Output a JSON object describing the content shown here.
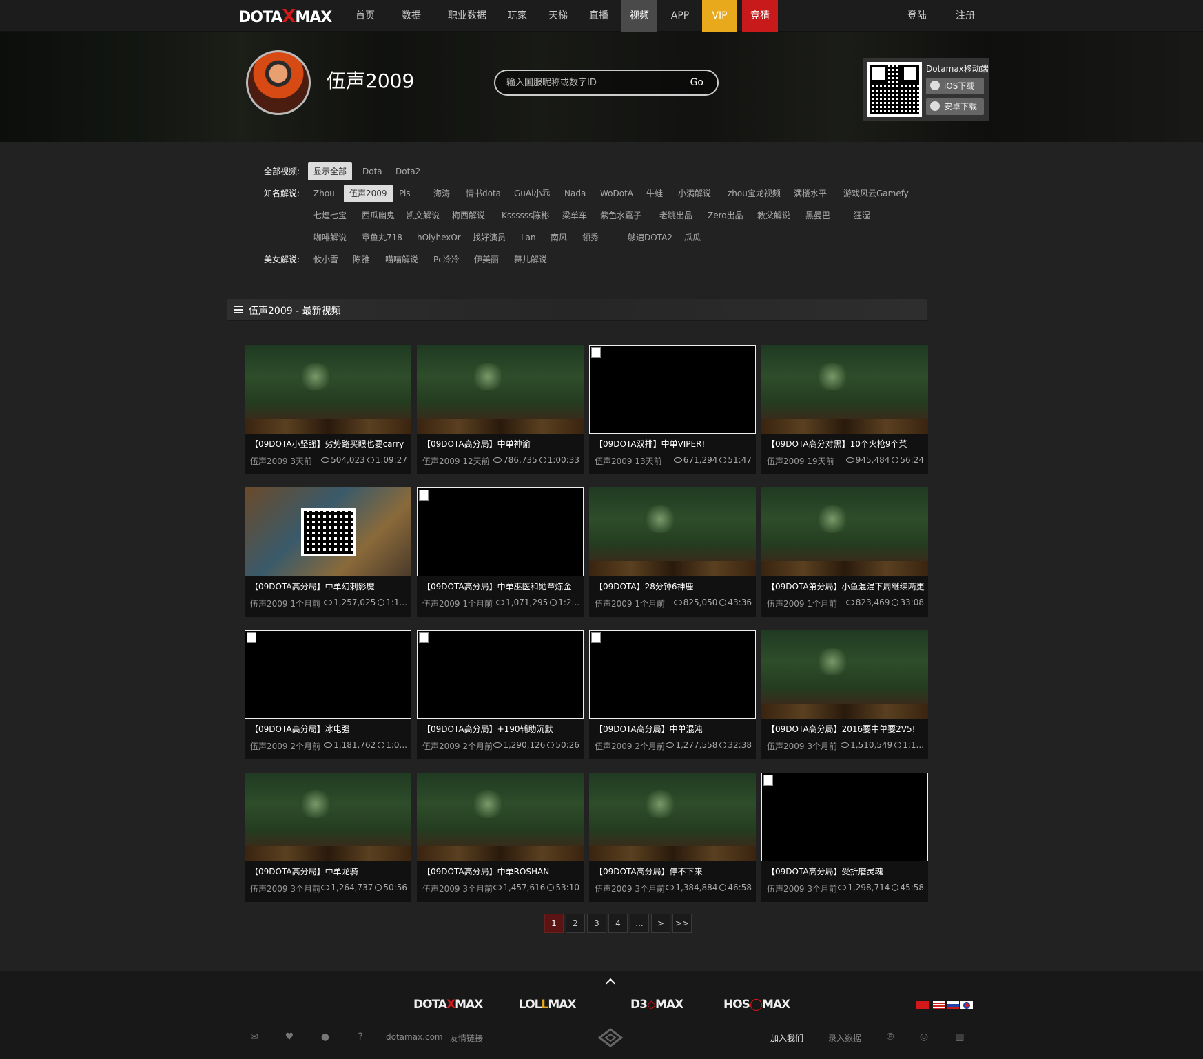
{
  "nav": {
    "logo_left": "DOTA",
    "logo_x": "X",
    "logo_right": "MAX",
    "items": [
      "首页",
      "数据",
      "职业数据",
      "玩家",
      "天梯",
      "直播",
      "视频",
      "APP",
      "VIP",
      "竞猜"
    ],
    "login": "登陆",
    "register": "注册",
    "active_item": "视频",
    "vip_color": "#e8a91c",
    "bet_color": "#c81a1a"
  },
  "profile": {
    "name": "伍声2009"
  },
  "search": {
    "placeholder": "输入国服昵称或数字ID",
    "go": "Go"
  },
  "mobile": {
    "title": "Dotamax移动端",
    "ios": "iOS下载",
    "android": "安卓下载"
  },
  "filters": {
    "all_label": "全部视频:",
    "all": [
      "显示全部",
      "Dota",
      "Dota2"
    ],
    "famous_label": "知名解说:",
    "famous_row1": [
      "Zhou",
      "伍声2009",
      "Pis",
      "海涛",
      "情书dota",
      "GuAi小乖",
      "Nada",
      "WoDotA",
      "牛蛙",
      "小满解说",
      "zhou宝龙视频",
      "满楼水平",
      "游戏风云Gamefy"
    ],
    "famous_row2": [
      "七煌七宝",
      "西瓜幽鬼",
      "凯文解说",
      "梅西解说",
      "Kssssss陈彬",
      "梁单车",
      "紫色水嘉子",
      "老跳出品",
      "Zero出品",
      "教父解说",
      "黑曼巴",
      "狂湿"
    ],
    "famous_row3": [
      "咖啡解说",
      "章鱼丸718",
      "hOlyhexOr",
      "找好演员",
      "Lan",
      "南风",
      "领秀",
      "够速DOTA2",
      "瓜瓜"
    ],
    "beauty_label": "美女解说:",
    "beauty": [
      "攸小雪",
      "陈雅",
      "喵喵解说",
      "Pc冷冷",
      "伊美丽",
      "舞儿解说"
    ]
  },
  "section": {
    "title": "伍声2009 - 最新视频"
  },
  "videos": [
    {
      "title": "【09DOTA小坚强】劣势路买眼也要carry",
      "author": "伍声2009",
      "time": "3天前",
      "views": "504,023",
      "duration": "1:09:27",
      "thumb": "img"
    },
    {
      "title": "【09DOTA高分局】中单神谕",
      "author": "伍声2009",
      "time": "12天前",
      "views": "786,735",
      "duration": "1:00:33",
      "thumb": "img"
    },
    {
      "title": "【09DOTA双排】中单VIPER!",
      "author": "伍声2009",
      "time": "13天前",
      "views": "671,294",
      "duration": "51:47",
      "thumb": "blank"
    },
    {
      "title": "【09DOTA高分对黑】10个火枪9个菜",
      "author": "伍声2009",
      "time": "19天前",
      "views": "945,484",
      "duration": "56:24",
      "thumb": "img"
    },
    {
      "title": "【09DOTA高分局】中单幻刺影魔",
      "author": "伍声2009",
      "time": "1个月前",
      "views": "1,257,025",
      "duration": "1:1...",
      "thumb": "qr"
    },
    {
      "title": "【09DOTA高分局】中单巫医和勋章炼金",
      "author": "伍声2009",
      "time": "1个月前",
      "views": "1,071,295",
      "duration": "1:2...",
      "thumb": "blank"
    },
    {
      "title": "【09DOTA】28分钟6神鹿",
      "author": "伍声2009",
      "time": "1个月前",
      "views": "825,050",
      "duration": "43:36",
      "thumb": "img"
    },
    {
      "title": "【09DOTA第分局】小鱼混混下周继续两更",
      "author": "伍声2009",
      "time": "1个月前",
      "views": "823,469",
      "duration": "33:08",
      "thumb": "img"
    },
    {
      "title": "【09DOTA高分局】冰电强",
      "author": "伍声2009",
      "time": "2个月前",
      "views": "1,181,762",
      "duration": "1:0...",
      "thumb": "blank"
    },
    {
      "title": "【09DOTA高分局】+190辅助沉默",
      "author": "伍声2009",
      "time": "2个月前",
      "views": "1,290,126",
      "duration": "50:26",
      "thumb": "blank"
    },
    {
      "title": "【09DOTA高分局】中单混沌",
      "author": "伍声2009",
      "time": "2个月前",
      "views": "1,277,558",
      "duration": "32:38",
      "thumb": "blank"
    },
    {
      "title": "【09DOTA高分局】2016要中单要2V5!",
      "author": "伍声2009",
      "time": "3个月前",
      "views": "1,510,549",
      "duration": "1:1...",
      "thumb": "img"
    },
    {
      "title": "【09DOTA高分局】中单龙骑",
      "author": "伍声2009",
      "time": "3个月前",
      "views": "1,264,737",
      "duration": "50:56",
      "thumb": "img"
    },
    {
      "title": "【09DOTA高分局】中单ROSHAN",
      "author": "伍声2009",
      "time": "3个月前",
      "views": "1,457,616",
      "duration": "53:10",
      "thumb": "img"
    },
    {
      "title": "【09DOTA高分局】停不下来",
      "author": "伍声2009",
      "time": "3个月前",
      "views": "1,384,884",
      "duration": "46:58",
      "thumb": "img"
    },
    {
      "title": "【09DOTA高分局】受折磨灵魂",
      "author": "伍声2009",
      "time": "3个月前",
      "views": "1,298,714",
      "duration": "45:58",
      "thumb": "blank"
    }
  ],
  "pager": [
    "1",
    "2",
    "3",
    "4",
    "...",
    ">",
    ">>"
  ],
  "current_page": "1",
  "footer": {
    "brands": [
      {
        "a": "DOTA",
        "m": "X",
        "b": "MAX"
      },
      {
        "a": "LOL",
        "m": "L",
        "b": "MAX"
      },
      {
        "a": "D3",
        "m": "◇",
        "b": "MAX"
      },
      {
        "a": "HOS",
        "m": "◯",
        "b": "MAX"
      }
    ],
    "site": "dotamax.com",
    "friend_links": "友情链接",
    "join": "加入我们",
    "submit": "录入数据"
  }
}
